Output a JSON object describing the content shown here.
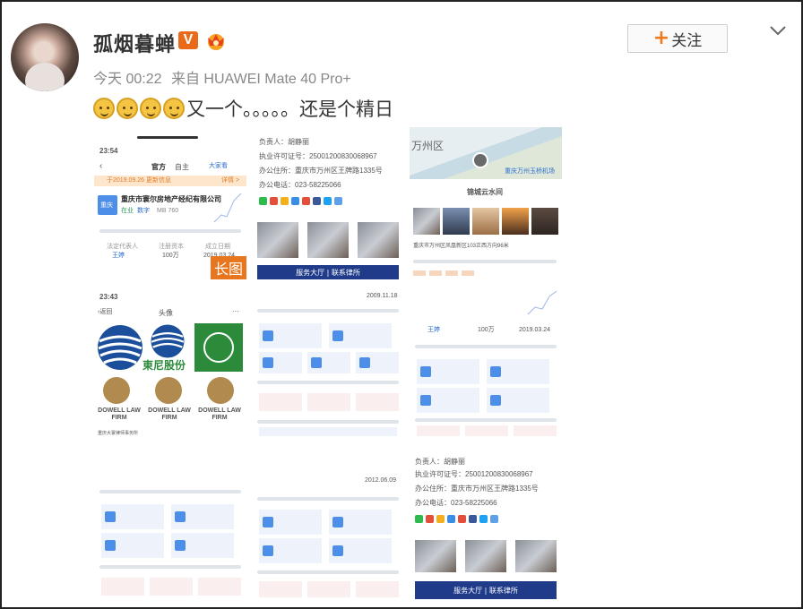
{
  "post": {
    "username": "孤烟暮蝉",
    "verified_badge": "V",
    "time": "今天 00:22",
    "source": "来自 HUAWEI Mate 40 Pro+",
    "text": "又一个。。。。。还是个精日",
    "emoji_count": 4,
    "emoji_icon": "dog-emoji-icon",
    "follow_plus": "+",
    "follow_label": "关注"
  },
  "images": {
    "long_image_tag": "长图",
    "shot1": {
      "status_time": "23:54",
      "tab_official": "官方",
      "tab_self": "自主",
      "badge": "大家看",
      "notice": "于2019.09.26 更新信息",
      "notice_link": "详情 >",
      "company": "重庆市寰尔房地产经纪有限公司",
      "status_tag": "在业",
      "tag2": "数字",
      "tag3": "MB 760",
      "col1": "法定代表人",
      "col2": "注册资本",
      "col3": "成立日期",
      "val1": "王婷",
      "val2": "100万",
      "val3": "2019.03.24",
      "left_tag": "重庆"
    },
    "shot2": {
      "manager": "负责人：胡静丽",
      "license": "执业许可证号：25001200830068967",
      "address": "办公住所：重庆市万州区王牌路1335号",
      "phone": "办公电话：023-58225066",
      "button": "服务大厅 | 联系律所"
    },
    "shot3": {
      "area": "万州区",
      "map_label": "重庆万州玉桥机场",
      "place_title": "锦城云水间",
      "place_address": "重庆市万州区凤凰新区103正西方向96米"
    },
    "shot4": {
      "status_time": "23:43",
      "back": "返回",
      "title": "头像",
      "logo_text": "東尼股份",
      "law_firm": "DOWELL LAW FIRM",
      "law_firm_cn": "重庆大寰律师事务所"
    },
    "shot5": {
      "date": "2009.11.18"
    },
    "shot6": {
      "val1": "王婷",
      "val2": "100万",
      "val3": "2019.03.24"
    },
    "shot8": {
      "date": "2012.06.09"
    },
    "shot9": {
      "manager": "负责人：胡静丽",
      "license": "执业许可证号：25001200830068967",
      "address": "办公住所：重庆市万州区王牌路1335号",
      "phone": "办公电话：023-58225066",
      "button": "服务大厅 | 联系律所"
    }
  },
  "colors": {
    "accent_orange": "#f07a1b",
    "verified_orange": "#e86a1a",
    "weibo_blue": "#1f3b8a"
  }
}
